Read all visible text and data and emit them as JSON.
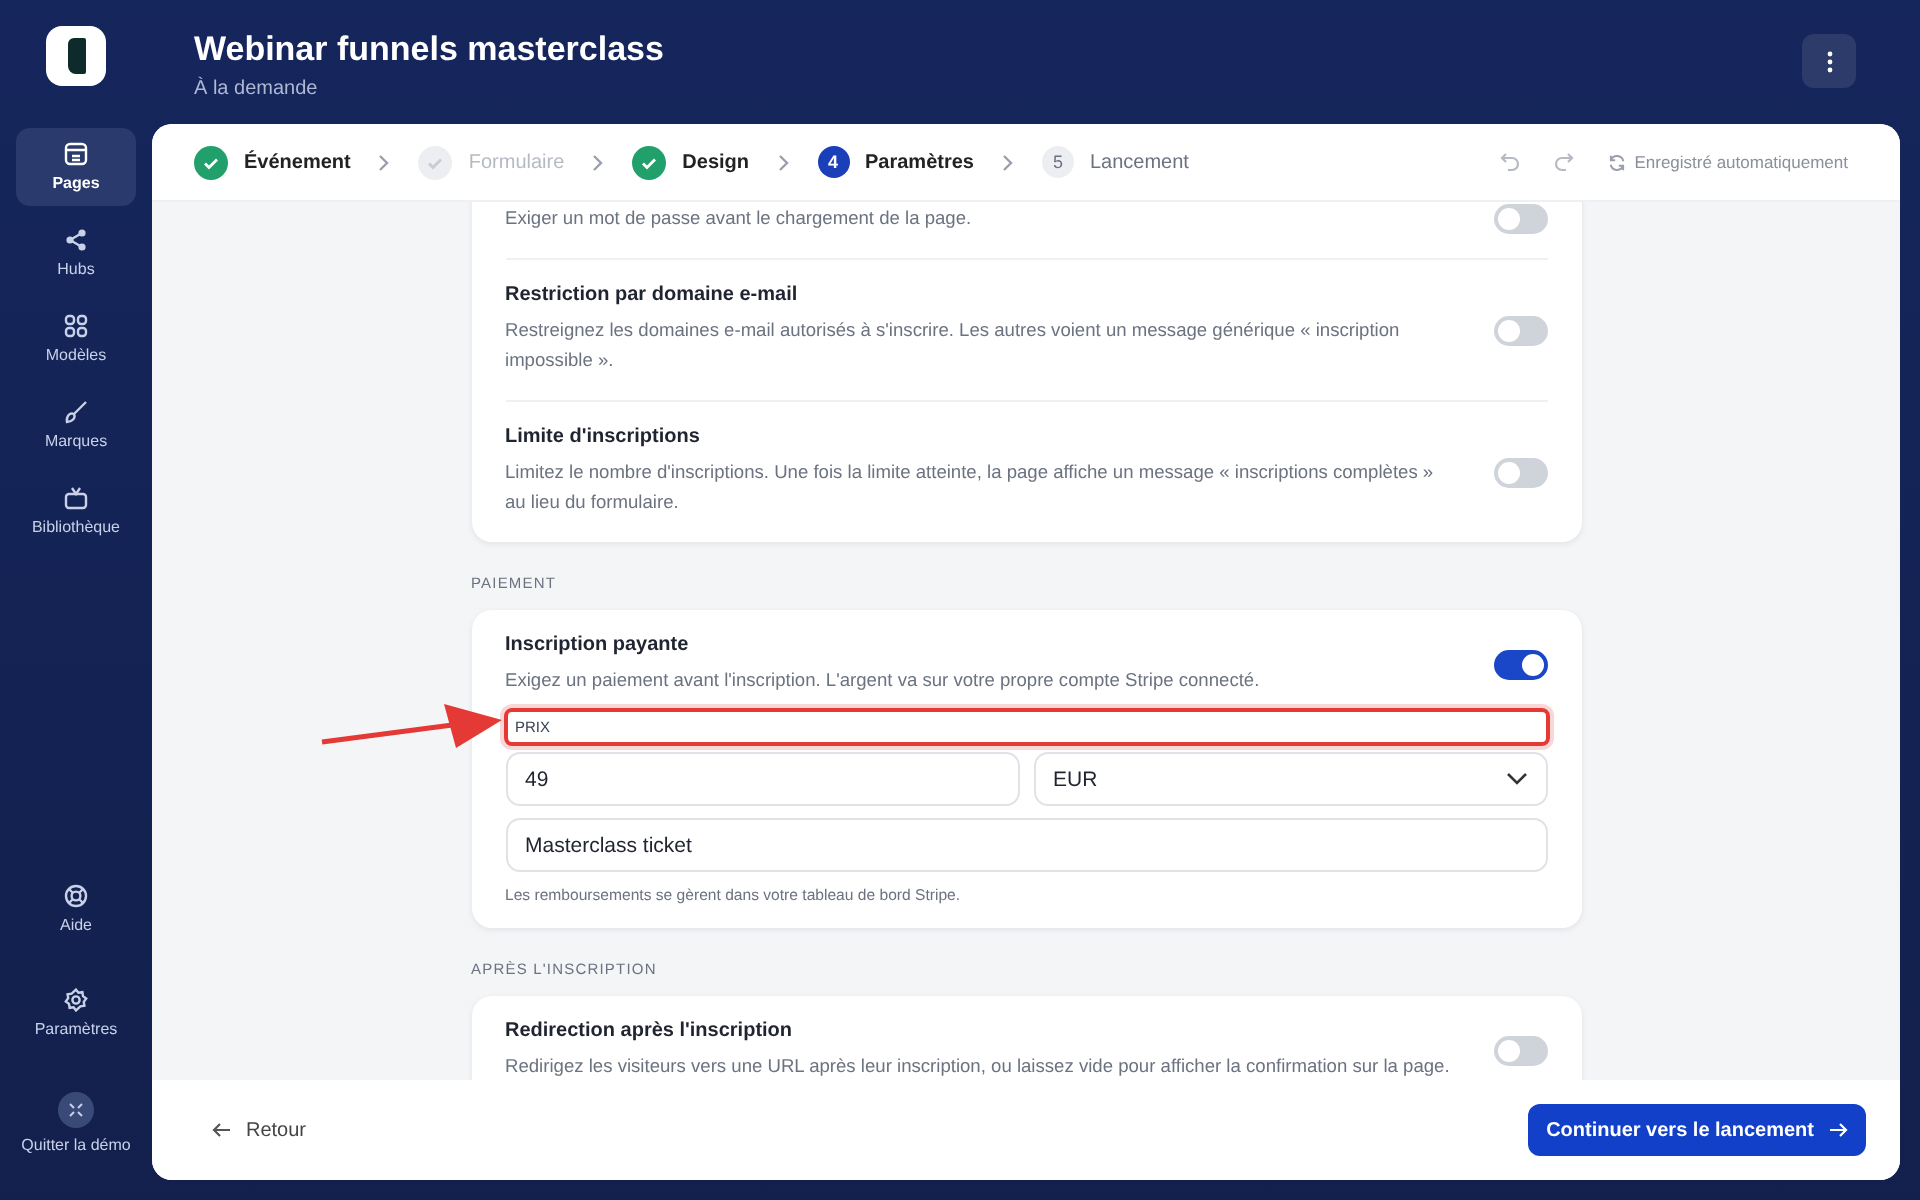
{
  "header": {
    "title": "Webinar funnels masterclass",
    "subtitle": "À la demande"
  },
  "sidebar": {
    "items": [
      {
        "label": "Pages",
        "selected": true
      },
      {
        "label": "Hubs",
        "selected": false
      },
      {
        "label": "Modèles",
        "selected": false
      },
      {
        "label": "Marques",
        "selected": false
      },
      {
        "label": "Bibliothèque",
        "selected": false
      }
    ],
    "bottom_items": [
      {
        "label": "Aide"
      },
      {
        "label": "Paramètres"
      },
      {
        "label": "Quitter la démo"
      }
    ]
  },
  "stepper": {
    "steps": [
      {
        "label": "Événement",
        "kind": "done"
      },
      {
        "label": "Formulaire",
        "kind": "skipped"
      },
      {
        "label": "Design",
        "kind": "done"
      },
      {
        "number": "4",
        "label": "Paramètres",
        "kind": "current"
      },
      {
        "number": "5",
        "label": "Lancement",
        "kind": "upcoming"
      }
    ],
    "autosave": "Enregistré automatiquement"
  },
  "sections": [
    {
      "settings": [
        {
          "description": "Exiger un mot de passe avant le chargement de la page.",
          "on": false
        },
        {
          "title": "Restriction par domaine e-mail",
          "description": "Restreignez les domaines e-mail autorisés à s'inscrire. Les autres voient un message générique « inscription impossible ».",
          "on": false
        },
        {
          "title": "Limite d'inscriptions",
          "description": "Limitez le nombre d'inscriptions. Une fois la limite atteinte, la page affiche un message « inscriptions complètes » au lieu du formulaire.",
          "on": false
        }
      ]
    },
    {
      "heading": "PAIEMENT",
      "settings": [
        {
          "title": "Inscription payante",
          "description": "Exigez un paiement avant l'inscription. L'argent va sur votre propre compte Stripe connecté.",
          "on": true,
          "price": {
            "label": "PRIX",
            "highlighted": true,
            "amount": "49",
            "currency": "EUR",
            "product": "Masterclass ticket",
            "note": "Les remboursements se gèrent dans votre tableau de bord Stripe."
          }
        }
      ]
    },
    {
      "heading": "APRÈS L'INSCRIPTION",
      "settings": [
        {
          "title": "Redirection après l'inscription",
          "description": "Redirigez les visiteurs vers une URL après leur inscription, ou laissez vide pour afficher la confirmation sur la page.",
          "on": false
        }
      ]
    }
  ],
  "footer": {
    "back": "Retour",
    "next": "Continuer vers le lancement"
  }
}
